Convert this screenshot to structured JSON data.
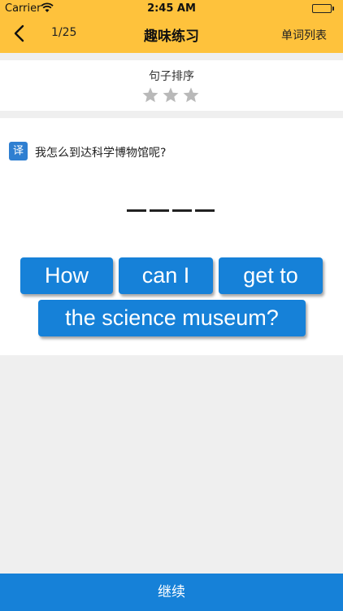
{
  "status": {
    "carrier": "Carrier",
    "time": "2:45 AM"
  },
  "nav": {
    "back_icon": "chevron-left-icon",
    "counter": "1/25",
    "title": "趣味练习",
    "word_list": "单词列表"
  },
  "exercise": {
    "type_label": "句子排序",
    "stars_total": 3,
    "stars_earned": 0,
    "translate_badge": "译",
    "prompt": "我怎么到达科学博物馆呢?",
    "blank_count": 4,
    "tiles": [
      "How",
      "can I",
      "get to",
      "the science museum?"
    ]
  },
  "colors": {
    "nav_bar": "#fec23c",
    "tile": "#1681d8",
    "badge": "#2f7fd1",
    "star_empty": "#b9b9b9"
  },
  "footer": {
    "continue": "继续"
  }
}
